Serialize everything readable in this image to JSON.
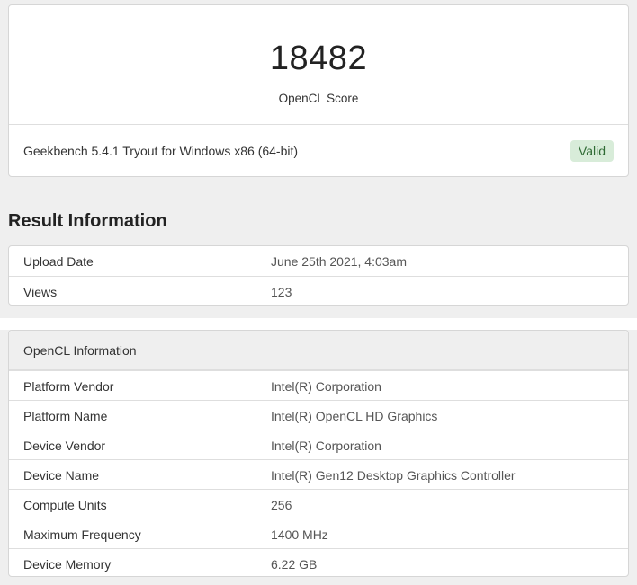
{
  "score": {
    "value": "18482",
    "label": "OpenCL Score",
    "version": "Geekbench 5.4.1 Tryout for Windows x86 (64-bit)",
    "badge": "Valid"
  },
  "result_section": {
    "title": "Result Information",
    "rows": [
      {
        "key": "Upload Date",
        "value": "June 25th 2021, 4:03am"
      },
      {
        "key": "Views",
        "value": "123"
      }
    ]
  },
  "opencl_section": {
    "header": "OpenCL Information",
    "rows": [
      {
        "key": "Platform Vendor",
        "value": "Intel(R) Corporation"
      },
      {
        "key": "Platform Name",
        "value": "Intel(R) OpenCL HD Graphics"
      },
      {
        "key": "Device Vendor",
        "value": "Intel(R) Corporation"
      },
      {
        "key": "Device Name",
        "value": "Intel(R) Gen12 Desktop Graphics Controller"
      },
      {
        "key": "Compute Units",
        "value": "256"
      },
      {
        "key": "Maximum Frequency",
        "value": "1400 MHz"
      },
      {
        "key": "Device Memory",
        "value": "6.22 GB"
      }
    ]
  },
  "colors": {
    "badge_bg": "#d8ecd9",
    "badge_text": "#2f6b34",
    "page_bg": "#efefef"
  }
}
